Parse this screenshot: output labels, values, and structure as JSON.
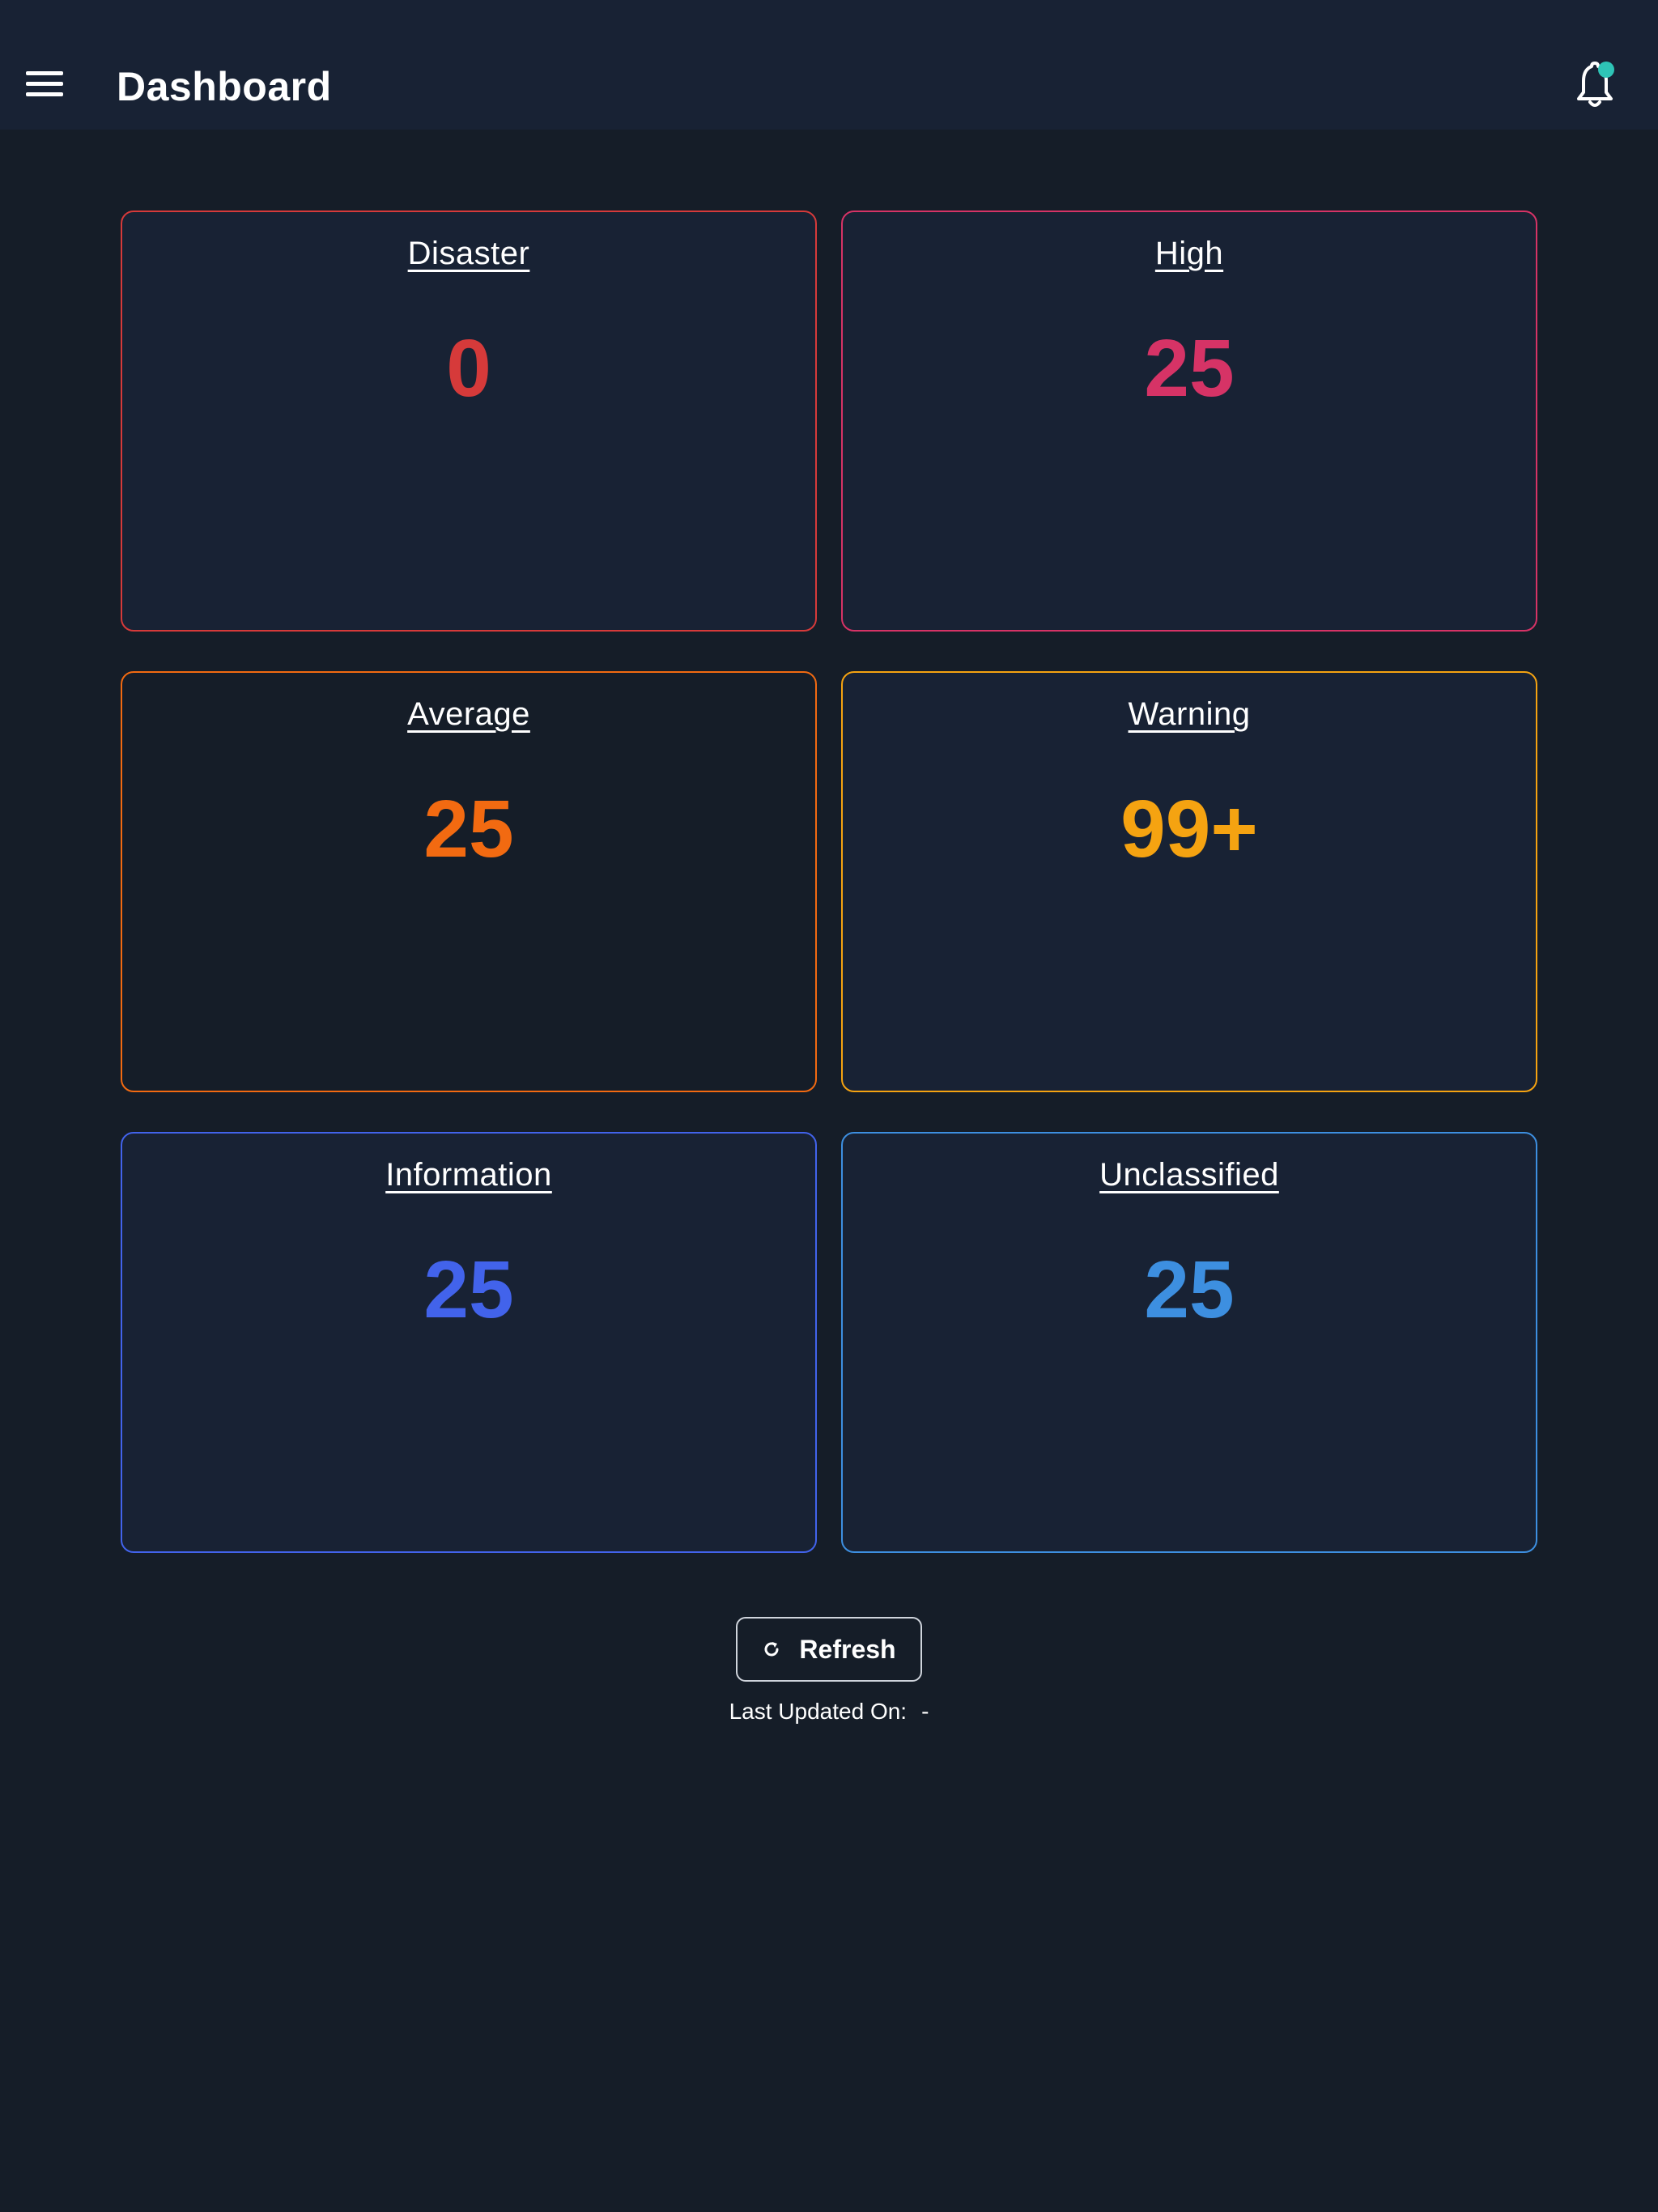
{
  "header": {
    "title": "Dashboard",
    "menu_icon": "hamburger-menu-icon",
    "notification_icon": "bell-icon",
    "notification_dot_color": "#2ec4b6"
  },
  "cards": [
    {
      "label": "Disaster",
      "value": "0",
      "color": "#d63a3a"
    },
    {
      "label": "High",
      "value": "25",
      "color": "#d63366"
    },
    {
      "label": "Average",
      "value": "25",
      "color": "#f26a11"
    },
    {
      "label": "Warning",
      "value": "99+",
      "color": "#f5a311"
    },
    {
      "label": "Information",
      "value": "25",
      "color": "#4263eb"
    },
    {
      "label": "Unclassified",
      "value": "25",
      "color": "#3d8fe0"
    }
  ],
  "refresh": {
    "label": "Refresh",
    "icon": "refresh-icon"
  },
  "last_updated": {
    "label": "Last Updated On:",
    "value": "-"
  }
}
